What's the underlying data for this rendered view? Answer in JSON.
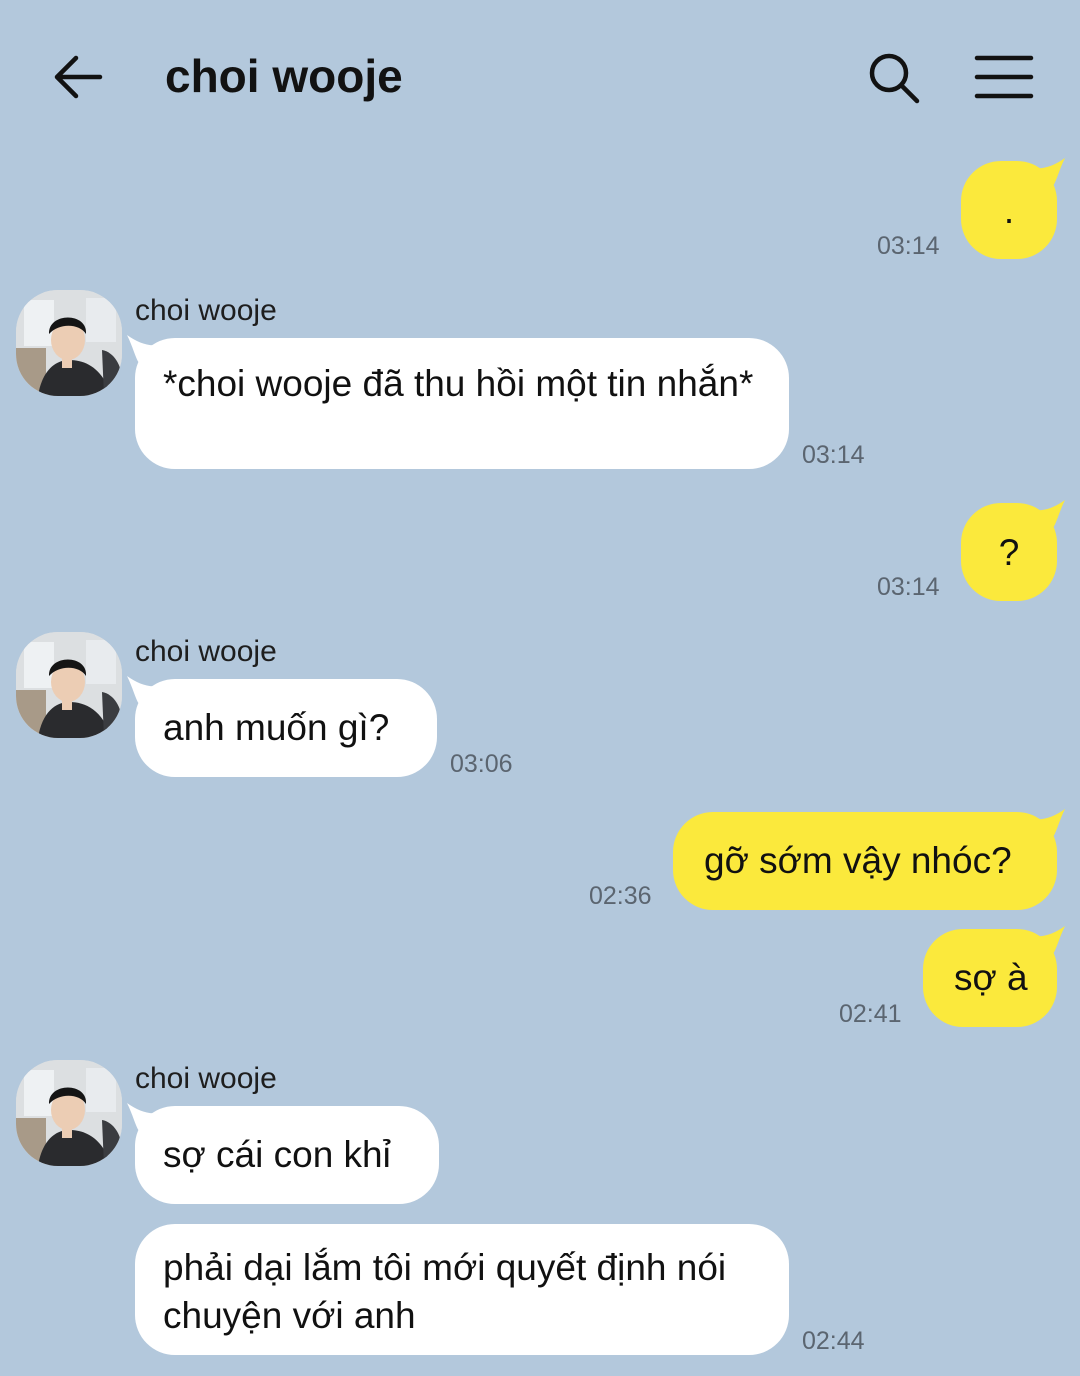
{
  "colors": {
    "background": "#b3c8dc",
    "incoming_bubble": "#ffffff",
    "outgoing_bubble": "#fbe93c",
    "text": "#111111",
    "time_text": "#5b6570"
  },
  "header": {
    "back_icon": "arrow-left-icon",
    "title": "choi wooje",
    "search_icon": "search-icon",
    "menu_icon": "hamburger-menu-icon"
  },
  "messages": [
    {
      "direction": "out",
      "text": ".",
      "time": "03:14"
    },
    {
      "direction": "in",
      "sender": "choi wooje",
      "text": "*choi wooje đã thu hồi một tin nhắn*",
      "time": "03:14"
    },
    {
      "direction": "out",
      "text": "?",
      "time": "03:14"
    },
    {
      "direction": "in",
      "sender": "choi wooje",
      "text": "anh muốn gì?",
      "time": "03:06"
    },
    {
      "direction": "out",
      "text": "gỡ sớm vậy nhóc?",
      "time": "02:36"
    },
    {
      "direction": "out",
      "text": "sợ à",
      "time": "02:41"
    },
    {
      "direction": "in",
      "sender": "choi wooje",
      "text": "sợ cái con khỉ"
    },
    {
      "direction": "in",
      "text": "phải dại lắm tôi mới quyết định nói chuyện với anh",
      "time": "02:44"
    }
  ]
}
